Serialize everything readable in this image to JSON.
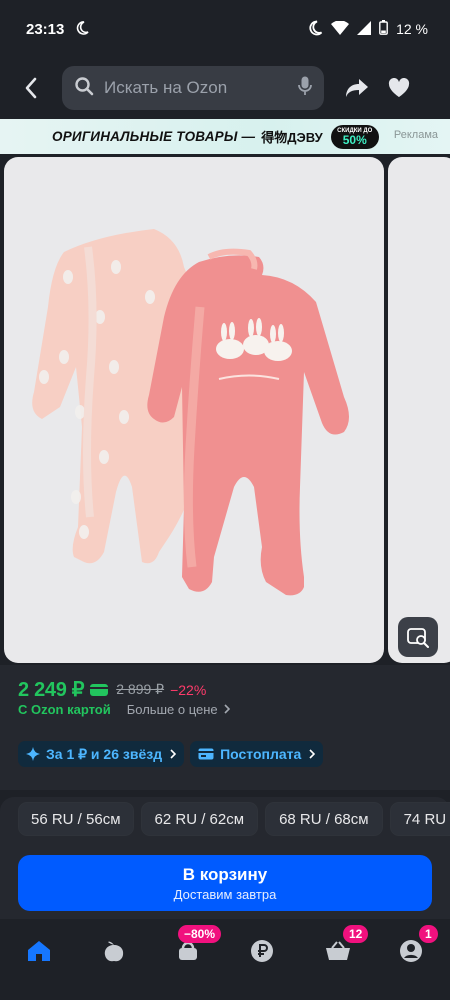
{
  "status_bar": {
    "time": "23:13",
    "battery": "12 %"
  },
  "search": {
    "placeholder": "Искать на Ozon"
  },
  "ad_banner": {
    "text": "ОРИГИНАЛЬНЫЕ ТОВАРЫ —",
    "brand": "得物ДЭВУ",
    "sale_top": "СКИДКИ ДО",
    "sale_value": "50%",
    "tag": "Реклама"
  },
  "product": {
    "price": "2 249 ₽",
    "old_price": "2 899 ₽",
    "discount": "−22%",
    "ozon_card_label": "С Ozon картой",
    "more_about_price": "Больше о цене",
    "stars_offer": "За 1 ₽ и 26 звёзд",
    "postpay": "Постоплата"
  },
  "sizes": [
    "56 RU / 56см",
    "62 RU / 62см",
    "68 RU / 68см",
    "74 RU"
  ],
  "cart": {
    "label": "В корзину",
    "sublabel": "Доставим завтра"
  },
  "bottom_nav": {
    "items": [
      "home-icon",
      "fresh-icon",
      "sale-icon",
      "finance-icon",
      "cart-icon",
      "profile-icon"
    ],
    "sale_badge": "−80%",
    "cart_badge": "12",
    "profile_badge": "1"
  },
  "colors": {
    "price_green": "#22c55e",
    "discount_red": "#ff3b6b",
    "ozon_blue": "#005bff",
    "badge_pink": "#f1117e",
    "background": "#1e2127"
  }
}
